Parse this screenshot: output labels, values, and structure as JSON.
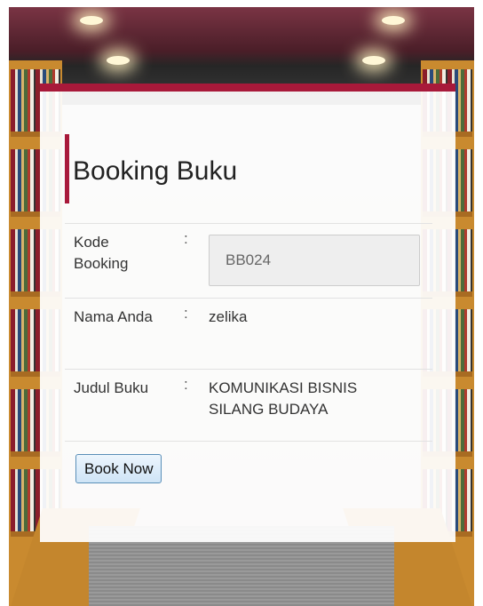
{
  "form": {
    "title": "Booking Buku",
    "fields": [
      {
        "label": "Kode Booking",
        "separator": ":",
        "value": "BB024"
      },
      {
        "label": "Nama Anda",
        "separator": ":",
        "value": "zelika"
      },
      {
        "label": "Judul Buku",
        "separator": ":",
        "value": "KOMUNIKASI BISNIS SILANG BUDAYA"
      }
    ],
    "submit_label": "Book Now"
  },
  "colors": {
    "accent": "#a8193a",
    "button_border": "#5a8fb8",
    "input_background": "#eeeeee"
  }
}
